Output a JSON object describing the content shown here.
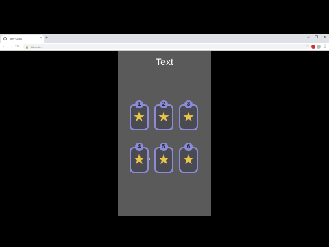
{
  "browser": {
    "tab_title": "Tiny Cook",
    "new_tab": "+",
    "url": "https://d...",
    "nav": {
      "back": "←",
      "forward": "→",
      "reload": "↻"
    },
    "window_controls": [
      "−",
      "❐",
      "✕"
    ],
    "tab_close": "×",
    "lock_glyph": "🔒",
    "bookmark_glyph": "☆",
    "menu_glyph": "⋮"
  },
  "page": {
    "title": "Text",
    "slots": [
      {
        "number": "1",
        "icon": "star-icon",
        "glyph": "★"
      },
      {
        "number": "2",
        "icon": "star-icon",
        "glyph": "★"
      },
      {
        "number": "3",
        "icon": "star-icon",
        "glyph": "★"
      },
      {
        "number": "4",
        "icon": "star-icon",
        "glyph": "★"
      },
      {
        "number": "5",
        "icon": "star-icon",
        "glyph": "★"
      },
      {
        "number": "6",
        "icon": "star-icon",
        "glyph": "★"
      }
    ]
  },
  "colors": {
    "page_bg": "#5a5a5a",
    "slot_frame": "#8b8bd6",
    "slot_inner": "#4a4a52",
    "star": "#e8c44a"
  }
}
